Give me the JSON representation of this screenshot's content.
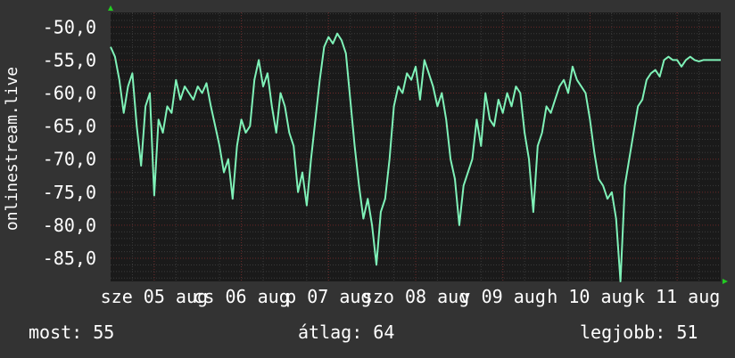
{
  "chart_data": {
    "type": "line",
    "ylabel": "onlinestream.live",
    "y_ticks": [
      "-50,0",
      "-55,0",
      "-60,0",
      "-65,0",
      "-70,0",
      "-75,0",
      "-80,0",
      "-85,0"
    ],
    "y_tick_values": [
      -50,
      -55,
      -60,
      -65,
      -70,
      -75,
      -80,
      -85
    ],
    "ylim": [
      -88.5,
      -47.8
    ],
    "x_tick_labels": [
      "sze 05 aug",
      "cs 06 aug",
      "p 07 aug",
      "szo 08 aug",
      "v 09 aug",
      "h 10 aug",
      "k 11 aug"
    ],
    "x_tick_positions": [
      0.5,
      1.5,
      2.5,
      3.5,
      4.5,
      5.5,
      6.5
    ],
    "xlim": [
      0.0,
      7.0
    ],
    "grid": true,
    "colors": {
      "background": "#333333",
      "plot_background": "#1a1a1a",
      "grid_major": "#6b2828",
      "grid_minor": "#3a3a3a",
      "line": "#7ff2b8",
      "axis_arrow": "#22cc22"
    },
    "series": [
      {
        "x": [
          0.0,
          0.05,
          0.1,
          0.15,
          0.2,
          0.25,
          0.3,
          0.35,
          0.4,
          0.45,
          0.5,
          0.55,
          0.6,
          0.65,
          0.7,
          0.75,
          0.8,
          0.85,
          0.9,
          0.95,
          1.0,
          1.05,
          1.1,
          1.15,
          1.2,
          1.25,
          1.3,
          1.35,
          1.4,
          1.45,
          1.5,
          1.55,
          1.6,
          1.65,
          1.7,
          1.75,
          1.8,
          1.85,
          1.9,
          1.95,
          2.0,
          2.05,
          2.1,
          2.15,
          2.2,
          2.25,
          2.3,
          2.35,
          2.4,
          2.45,
          2.5,
          2.55,
          2.6,
          2.65,
          2.7,
          2.75,
          2.8,
          2.85,
          2.9,
          2.95,
          3.0,
          3.05,
          3.1,
          3.15,
          3.2,
          3.25,
          3.3,
          3.35,
          3.4,
          3.45,
          3.5,
          3.55,
          3.6,
          3.65,
          3.7,
          3.75,
          3.8,
          3.85,
          3.9,
          3.95,
          4.0,
          4.05,
          4.1,
          4.15,
          4.2,
          4.25,
          4.3,
          4.35,
          4.4,
          4.45,
          4.5,
          4.55,
          4.6,
          4.65,
          4.7,
          4.75,
          4.8,
          4.85,
          4.9,
          4.95,
          5.0,
          5.05,
          5.1,
          5.15,
          5.2,
          5.25,
          5.3,
          5.35,
          5.4,
          5.45,
          5.5,
          5.55,
          5.6,
          5.65,
          5.7,
          5.75,
          5.8,
          5.85,
          5.9,
          5.95,
          6.0,
          6.05,
          6.1,
          6.15,
          6.2,
          6.25,
          6.3,
          6.35,
          6.4,
          6.45,
          6.5,
          6.55,
          6.6,
          6.65,
          6.7,
          6.75,
          6.8,
          6.85,
          6.9,
          6.95,
          7.0
        ],
        "values": [
          -53.0,
          -54.5,
          -58.0,
          -63.0,
          -59.0,
          -57.0,
          -65.0,
          -71.0,
          -62.0,
          -60.0,
          -75.5,
          -64.0,
          -66.0,
          -62.0,
          -63.0,
          -58.0,
          -61.0,
          -59.0,
          -60.0,
          -61.0,
          -59.0,
          -60.0,
          -58.5,
          -62.0,
          -65.0,
          -68.0,
          -72.0,
          -70.0,
          -76.0,
          -68.0,
          -64.0,
          -66.0,
          -65.0,
          -58.0,
          -55.0,
          -59.0,
          -57.0,
          -62.0,
          -66.0,
          -60.0,
          -62.0,
          -66.0,
          -68.0,
          -75.0,
          -72.0,
          -77.0,
          -70.0,
          -64.0,
          -58.0,
          -53.0,
          -51.5,
          -52.5,
          -51.0,
          -52.0,
          -54.0,
          -61.0,
          -68.0,
          -74.0,
          -79.0,
          -76.0,
          -80.0,
          -86.0,
          -78.0,
          -76.0,
          -70.0,
          -62.0,
          -59.0,
          -60.0,
          -57.0,
          -58.0,
          -56.0,
          -61.0,
          -55.0,
          -57.0,
          -59.0,
          -62.0,
          -60.0,
          -64.0,
          -70.0,
          -73.0,
          -80.0,
          -74.0,
          -72.0,
          -70.0,
          -64.0,
          -68.0,
          -60.0,
          -64.0,
          -65.0,
          -61.0,
          -63.0,
          -60.0,
          -62.0,
          -59.0,
          -60.0,
          -66.0,
          -70.0,
          -78.0,
          -68.0,
          -66.0,
          -62.0,
          -63.0,
          -61.0,
          -59.0,
          -58.0,
          -60.0,
          -56.0,
          -58.0,
          -59.0,
          -60.0,
          -64.0,
          -69.0,
          -73.0,
          -74.0,
          -76.0,
          -75.0,
          -79.0,
          -88.5,
          -74.0,
          -70.0,
          -66.0,
          -62.0,
          -61.0,
          -58.0,
          -57.0,
          -56.5,
          -57.5,
          -55.0,
          -54.5,
          -55.0,
          -55.0,
          -56.0,
          -55.0,
          -54.5,
          -55.0,
          -55.2,
          -55.0,
          -55.0,
          -55.0,
          -55.0,
          -55.0
        ]
      }
    ]
  },
  "stats": {
    "now": "most: 55",
    "avg": "átlag: 64",
    "best": "legjobb: 51"
  }
}
